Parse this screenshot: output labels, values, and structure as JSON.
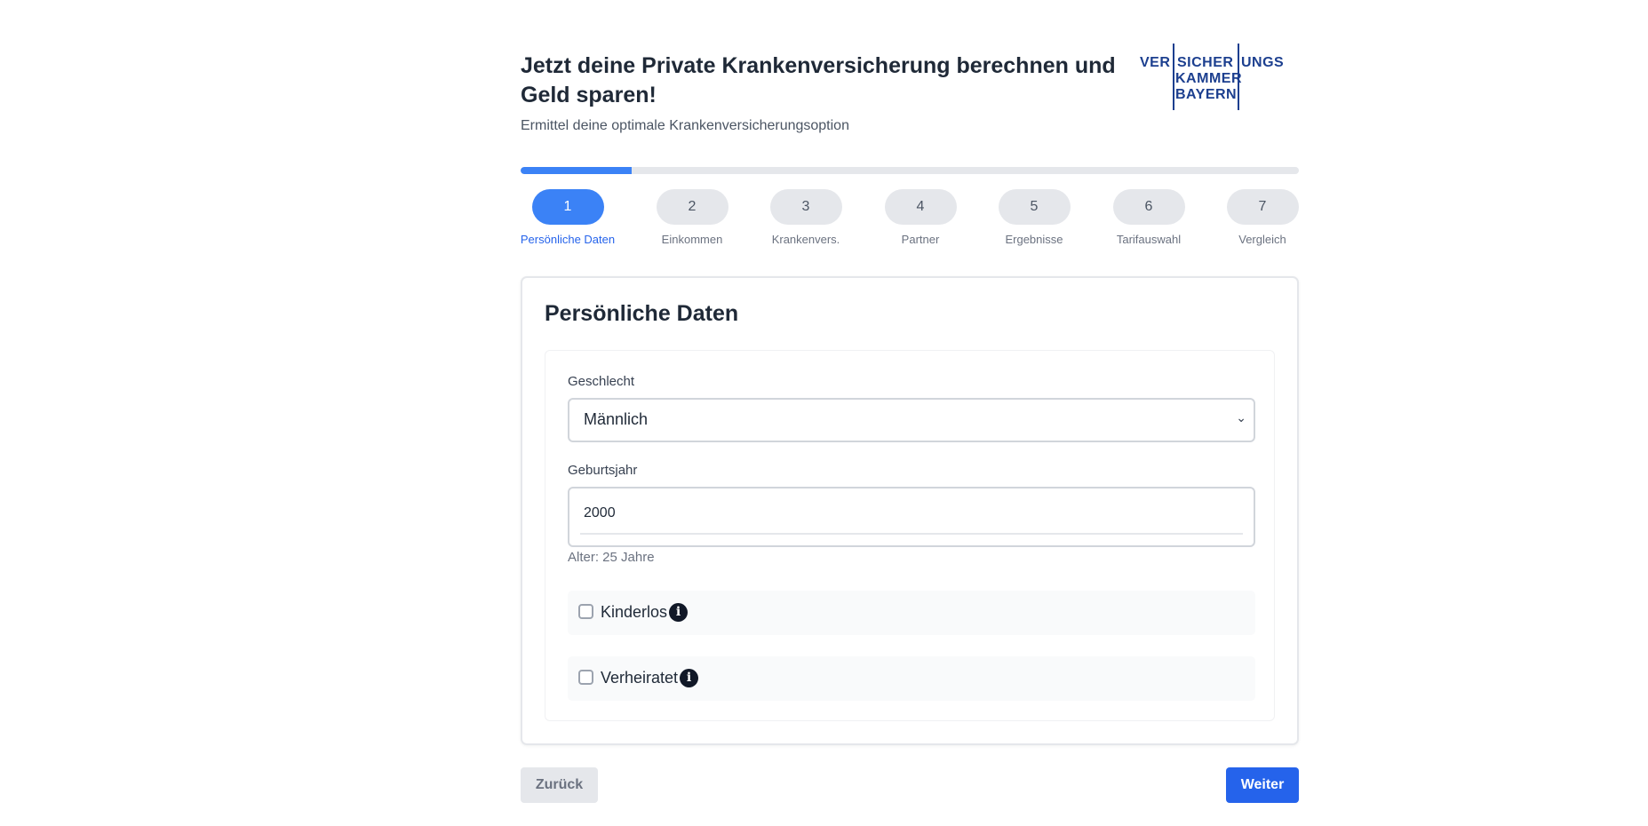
{
  "header": {
    "title": "Jetzt deine Private Krankenversicherung berechnen und Geld sparen!",
    "subtitle": "Ermittel deine optimale Krankenversicherungsoption"
  },
  "logo": {
    "line1_left": "VER",
    "line1_mid": "SICHER",
    "line1_right": "UNGS",
    "line2": "KAMMER",
    "line3": "BAYERN",
    "color": "#1c3f8f"
  },
  "progress": {
    "fraction": 0.143,
    "color": "#3b82f6"
  },
  "steps": [
    {
      "number": "1",
      "label": "Persönliche Daten",
      "active": true
    },
    {
      "number": "2",
      "label": "Einkommen",
      "active": false
    },
    {
      "number": "3",
      "label": "Krankenvers.",
      "active": false
    },
    {
      "number": "4",
      "label": "Partner",
      "active": false
    },
    {
      "number": "5",
      "label": "Ergebnisse",
      "active": false
    },
    {
      "number": "6",
      "label": "Tarifauswahl",
      "active": false
    },
    {
      "number": "7",
      "label": "Vergleich",
      "active": false
    }
  ],
  "card": {
    "title": "Persönliche Daten",
    "gender": {
      "label": "Geschlecht",
      "value": "Männlich"
    },
    "birth_year": {
      "label": "Geburtsjahr",
      "value": "2000",
      "helper": "Alter: 25 Jahre"
    },
    "childless": {
      "label": "Kinderlos",
      "checked": false,
      "info_icon": "info-icon"
    },
    "married": {
      "label": "Verheiratet",
      "checked": false,
      "info_icon": "info-icon"
    }
  },
  "footer": {
    "back_label": "Zurück",
    "next_label": "Weiter"
  },
  "colors": {
    "accent": "#3b82f6",
    "primary_button": "#2563eb",
    "secondary_button": "#e5e7eb"
  }
}
